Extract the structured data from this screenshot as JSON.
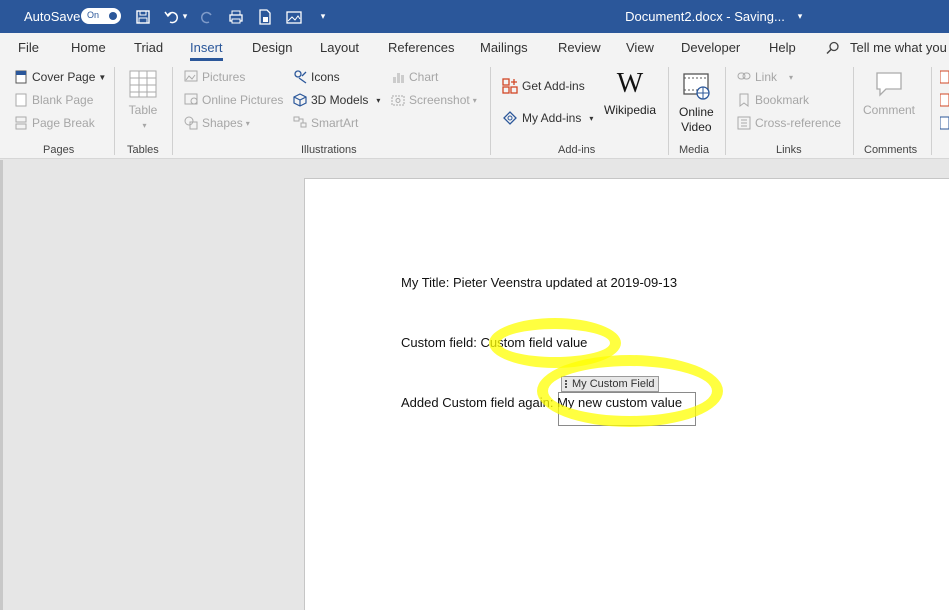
{
  "titlebar": {
    "autosave_label": "AutoSave",
    "toggle_label": "On",
    "doc_title": "Document2.docx  -  Saving...",
    "caret": "▾"
  },
  "tabs": [
    "File",
    "Home",
    "Triad",
    "Insert",
    "Design",
    "Layout",
    "References",
    "Mailings",
    "Review",
    "View",
    "Developer",
    "Help"
  ],
  "active_tab": "Insert",
  "tell_me": "Tell me what you",
  "ribbon": {
    "pages": {
      "cover_page": "Cover Page",
      "blank_page": "Blank Page",
      "page_break": "Page Break",
      "group": "Pages"
    },
    "tables": {
      "table": "Table",
      "group": "Tables"
    },
    "illustrations": {
      "pictures": "Pictures",
      "online_pictures": "Online Pictures",
      "shapes": "Shapes",
      "icons": "Icons",
      "models": "3D Models",
      "smartart": "SmartArt",
      "chart": "Chart",
      "screenshot": "Screenshot",
      "group": "Illustrations"
    },
    "addins": {
      "get": "Get Add-ins",
      "my": "My Add-ins",
      "wikipedia": "Wikipedia",
      "group": "Add-ins"
    },
    "media": {
      "online_video_1": "Online",
      "online_video_2": "Video",
      "group": "Media"
    },
    "links": {
      "link": "Link",
      "bookmark": "Bookmark",
      "cross_ref": "Cross-reference",
      "group": "Links"
    },
    "comments": {
      "comment": "Comment",
      "group": "Comments"
    }
  },
  "document": {
    "line1": "My Title: Pieter Veenstra updated at 2019-09-13",
    "line2": "Custom field: Custom field value",
    "cc_title": "My Custom Field",
    "line3": "Added Custom field again: My new custom value"
  },
  "colors": {
    "brand": "#2b579a",
    "highlight": "#ffff00"
  }
}
